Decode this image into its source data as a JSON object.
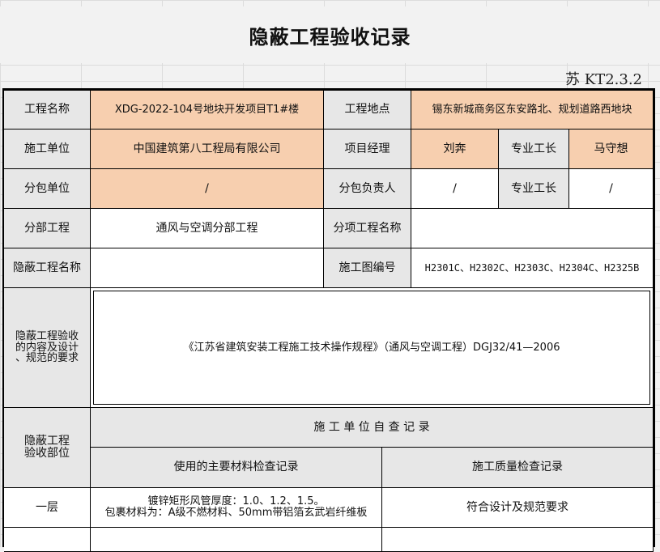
{
  "title": "隐蔽工程验收记录",
  "form_code": "苏 KT2.3.2",
  "row1": {
    "project_name_label": "工程名称",
    "project_name": "XDG-2022-104号地块开发项目T1#楼",
    "location_label": "工程地点",
    "location": "锡东新城商务区东安路北、规划道路西地块"
  },
  "row2": {
    "contractor_label": "施工单位",
    "contractor": "中国建筑第八工程局有限公司",
    "manager_label": "项目经理",
    "manager": "刘奔",
    "foreman_label": "专业工长",
    "foreman": "马守想"
  },
  "row3": {
    "sub_label": "分包单位",
    "sub": "/",
    "sub_head_label": "分包负责人",
    "sub_head": "/",
    "foreman_label": "专业工长",
    "foreman": "/"
  },
  "row4": {
    "division_label": "分部工程",
    "division": "通风与空调分部工程",
    "item_label": "分项工程名称",
    "item": ""
  },
  "row5": {
    "hidden_name_label": "隐蔽工程名称",
    "hidden_name": "",
    "drawing_label": "施工图编号",
    "drawing_numbers": "H2301C、H2302C、H2303C、H2304C、H2325B"
  },
  "row6": {
    "content_label_lines": [
      "隐蔽工程验收",
      "的内容及设计",
      "、规范的要求"
    ],
    "content": "《江苏省建筑安装工程施工技术操作规程》（通风与空调工程）DGJ32/41—2006"
  },
  "row7": {
    "part_label_lines": [
      "隐蔽工程",
      "验收部位"
    ],
    "self_check_header": "施 工 单 位 自 查 记 录",
    "materials_header": "使用的主要材料检查记录",
    "quality_header": "施工质量检查记录"
  },
  "row8": {
    "part": "一层",
    "materials_lines": [
      "镀锌矩形风管厚度：1.0、1.2、1.5。",
      "包裹材料为：A级不燃材料、50mm带铝箔玄武岩纤维板"
    ],
    "quality": "符合设计及规范要求"
  }
}
